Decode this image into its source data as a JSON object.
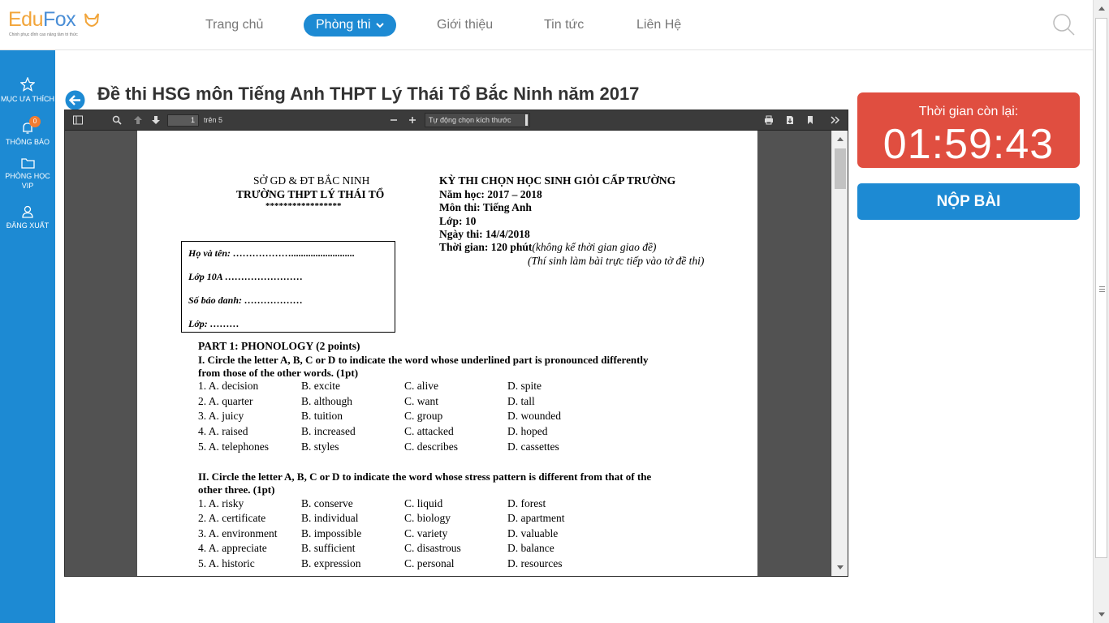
{
  "logo": {
    "brand_part1": "Edu",
    "brand_part2": "Fox",
    "tagline": "Chinh phục đỉnh cao nâng tầm tri thức"
  },
  "nav": {
    "items": [
      "Trang chủ",
      "Phòng thi",
      "Giới thiệu",
      "Tin tức",
      "Liên Hệ"
    ],
    "active_index": 1
  },
  "sidebar": {
    "favorites": "MỤC ƯA THÍCH",
    "notifications": "THÔNG BÁO",
    "notifications_count": "0",
    "vip_line1": "PHÒNG HỌC",
    "vip_line2": "VIP",
    "logout": "ĐĂNG XUẤT"
  },
  "page_title": "Đề thi HSG môn Tiếng Anh THPT Lý Thái Tổ Bắc Ninh năm 2017",
  "viewer": {
    "page_number": "1",
    "page_of": "trên 5",
    "zoom": "Tự động chọn kích thước"
  },
  "doc": {
    "dept": "SỞ GD & ĐT BẮC NINH",
    "school": "TRƯỜNG THPT LÝ THÁI TỔ",
    "stars": "*****************",
    "exam_title": "KỲ THI CHỌN HỌC SINH GIỎI CẤP TRƯỜNG",
    "year": "Năm học: 2017 – 2018",
    "subject": "Môn thi: Tiếng Anh",
    "grade": "Lớp: 10",
    "date": "Ngày thi: 14/4/2018",
    "time_bold": "Thời gian: 120 phút",
    "time_note": "(không kể thời gian giao đề)",
    "direct_note": "(Thí sinh làm bài trực tiếp vào tờ đề thi)",
    "box": {
      "name": "Họ và tên: ………………..........................",
      "class10": "Lớp 10A ……………………",
      "sbd": "Số báo danh: ………………",
      "lop": "Lớp: ………"
    },
    "part1": "PART 1: PHONOLOGY (2 points)",
    "sec1_line1": "I. Circle the letter A, B, C or D to indicate the word whose underlined part is pronounced differently",
    "sec1_line2": "from those of the other words. (1pt)",
    "sec1_rows": [
      [
        "1. A. decision",
        "B. excite",
        "C. alive",
        "D. spite"
      ],
      [
        "2. A. quarter",
        "B. although",
        "C. want",
        "D. tall"
      ],
      [
        "3. A. juicy",
        "B. tuition",
        "C. group",
        "D. wounded"
      ],
      [
        "4. A. raised",
        "B. increased",
        "C. attacked",
        "D. hoped"
      ],
      [
        "5. A. telephones",
        "B. styles",
        "C. describes",
        "D. cassettes"
      ]
    ],
    "sec2_line1": "II. Circle the letter A, B, C or D to indicate the word whose stress pattern is different from that of the",
    "sec2_line2": "other three. (1pt)",
    "sec2_rows": [
      [
        "1. A. risky",
        "B. conserve",
        "C. liquid",
        "D. forest"
      ],
      [
        "2. A. certificate",
        "B. individual",
        "C. biology",
        "D. apartment"
      ],
      [
        "3. A. environment",
        "B. impossible",
        "C. variety",
        "D. valuable"
      ],
      [
        "4. A. appreciate",
        "B. sufficient",
        "C. disastrous",
        "D. balance"
      ],
      [
        "5. A. historic",
        "B. expression",
        "C. personal",
        "D. resources"
      ]
    ]
  },
  "timer": {
    "label": "Thời gian còn lại:",
    "value": "01:59:43"
  },
  "submit_label": "NỘP BÀI"
}
